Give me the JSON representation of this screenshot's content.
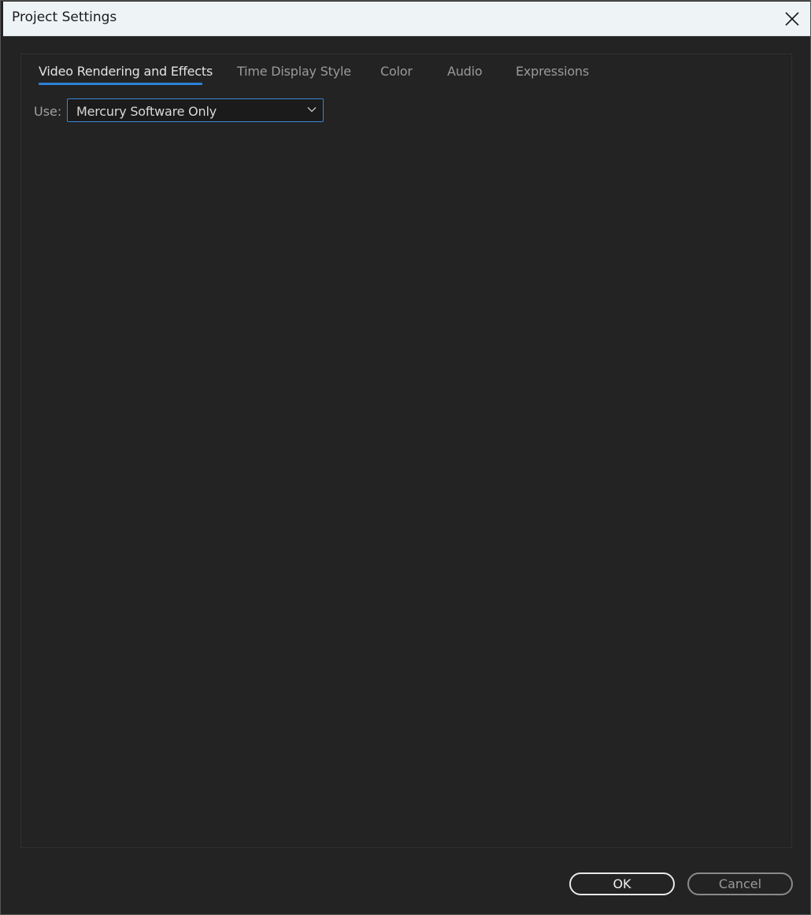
{
  "window": {
    "title": "Project Settings"
  },
  "tabs": [
    {
      "label": "Video Rendering and Effects",
      "active": true
    },
    {
      "label": "Time Display Style",
      "active": false
    },
    {
      "label": "Color",
      "active": false
    },
    {
      "label": "Audio",
      "active": false
    },
    {
      "label": "Expressions",
      "active": false
    }
  ],
  "renderer": {
    "label": "Use:",
    "selected": "Mercury Software Only"
  },
  "buttons": {
    "ok": "OK",
    "cancel": "Cancel"
  },
  "icons": {
    "close": "close-icon",
    "dropdown": "chevron-down-icon"
  },
  "colors": {
    "accent": "#2c82d8",
    "background": "#232323",
    "titlebar": "#eef4f6"
  }
}
